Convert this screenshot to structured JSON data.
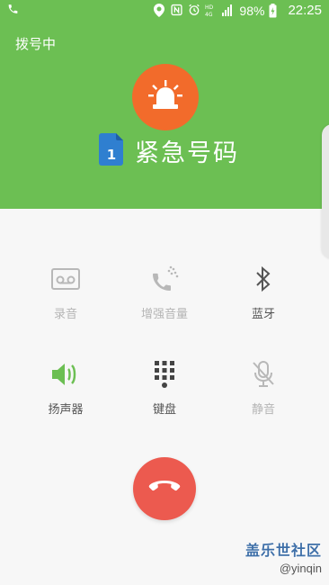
{
  "statusbar": {
    "battery": "98%",
    "time": "22:25",
    "network_small": "HD\n4G",
    "icons": [
      "phone-icon",
      "location-icon",
      "nfc-icon",
      "alarm-icon",
      "volte-icon",
      "signal-icon",
      "battery-charging-icon"
    ]
  },
  "call": {
    "status": "拨号中",
    "callee": "紧急号码",
    "sim_slot": "1"
  },
  "controls": [
    {
      "label": "录音",
      "icon": "voicemail-record-icon",
      "enabled": false
    },
    {
      "label": "增强音量",
      "icon": "volume-boost-icon",
      "enabled": false
    },
    {
      "label": "蓝牙",
      "icon": "bluetooth-icon",
      "enabled": true
    },
    {
      "label": "扬声器",
      "icon": "speaker-icon",
      "enabled": true,
      "active": true
    },
    {
      "label": "键盘",
      "icon": "dialpad-icon",
      "enabled": true
    },
    {
      "label": "静音",
      "icon": "mute-icon",
      "enabled": false
    }
  ],
  "end_call": {
    "icon": "end-call-icon"
  },
  "watermark": {
    "title": "盖乐世社区",
    "user": "@yinqin"
  },
  "colors": {
    "header": "#6cbf53",
    "avatar": "#f26b2b",
    "end_call": "#ec5a4f",
    "speaker_active": "#6cbf53"
  }
}
